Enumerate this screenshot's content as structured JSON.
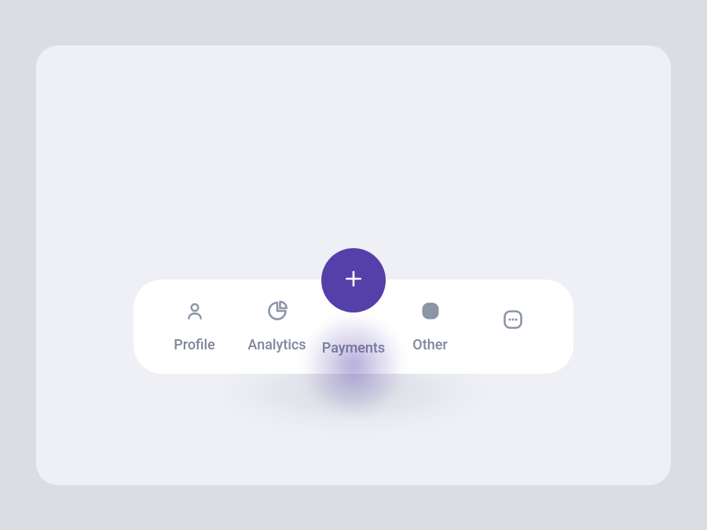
{
  "colors": {
    "page_bg": "#dbdde3",
    "card_bg": "#eef0f6",
    "nav_bg": "#ffffff",
    "accent": "#5540a9",
    "icon_muted": "#8b95a8",
    "text_muted": "#7e879a"
  },
  "fab": {
    "icon_name": "plus-icon"
  },
  "nav": {
    "items": [
      {
        "label": "Profile",
        "icon_name": "user-icon"
      },
      {
        "label": "Analytics",
        "icon_name": "pie-chart-icon"
      },
      {
        "label": "Payments",
        "icon_name": "plus-icon"
      },
      {
        "label": "Other",
        "icon_name": "squircle-icon"
      },
      {
        "label": "",
        "icon_name": "more-icon"
      }
    ]
  }
}
